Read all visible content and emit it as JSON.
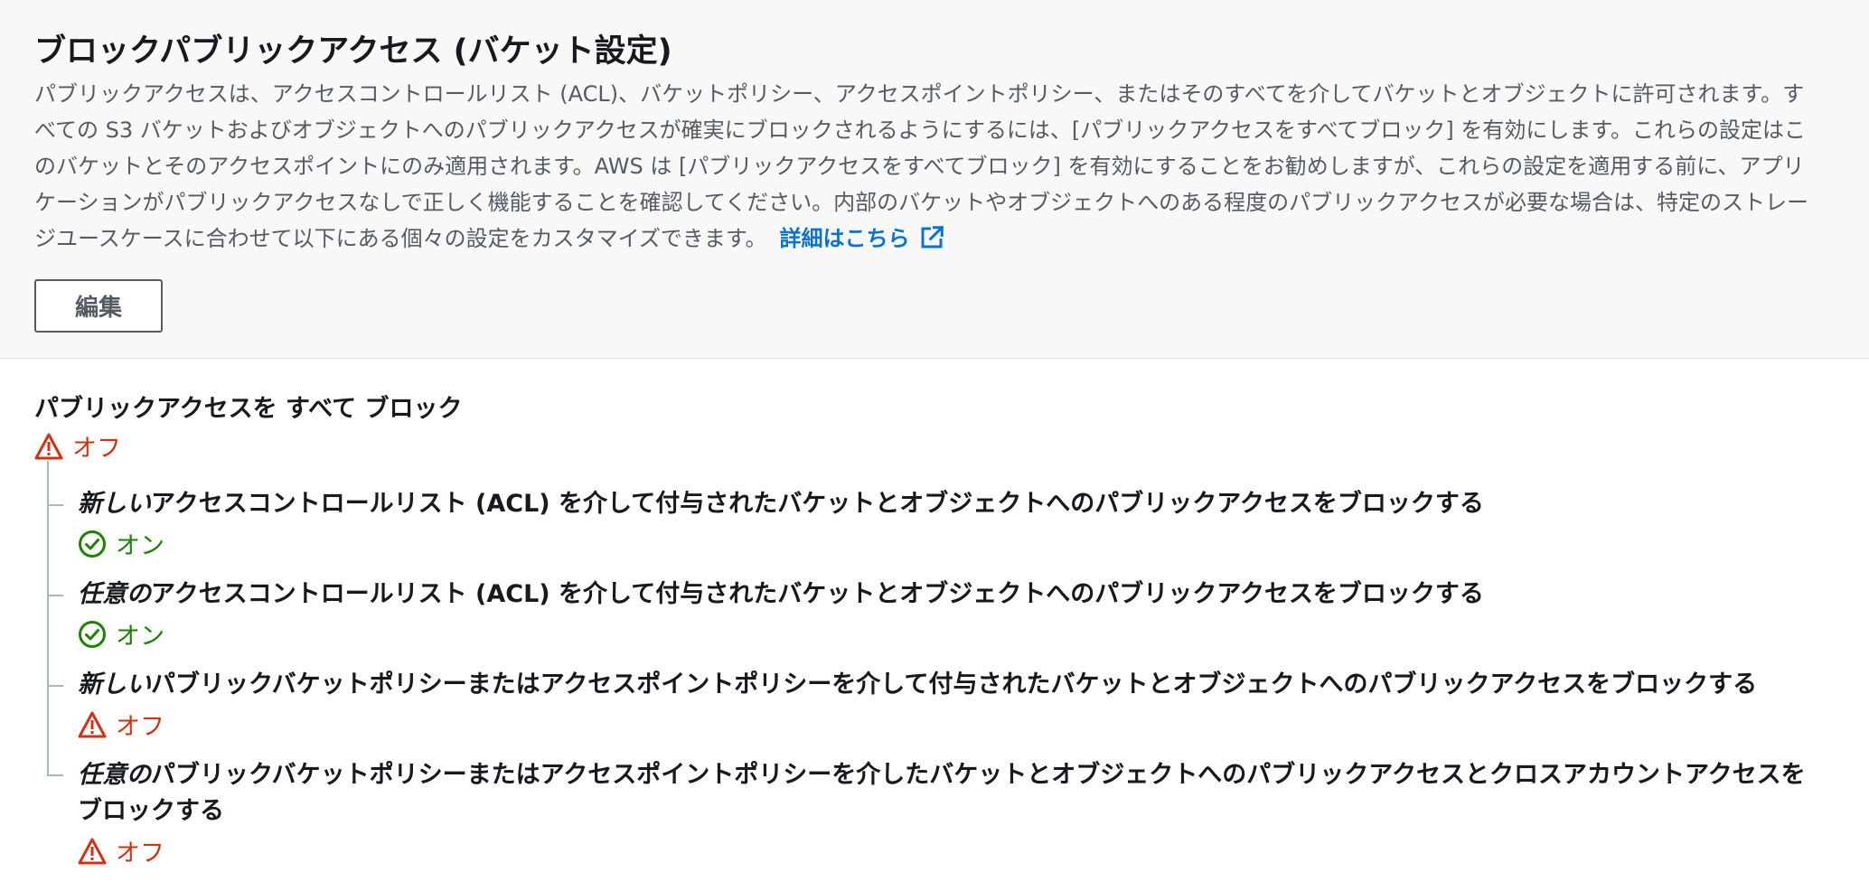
{
  "header": {
    "title": "ブロックパブリックアクセス (バケット設定)",
    "description": "パブリックアクセスは、アクセスコントロールリスト (ACL)、バケットポリシー、アクセスポイントポリシー、またはそのすべてを介してバケットとオブジェクトに許可されます。すべての S3 バケットおよびオブジェクトへのパブリックアクセスが確実にブロックされるようにするには、[パブリックアクセスをすべてブロック] を有効にします。これらの設定はこのバケットとそのアクセスポイントにのみ適用されます。AWS は [パブリックアクセスをすべてブロック] を有効にすることをお勧めしますが、これらの設定を適用する前に、アプリケーションがパブリックアクセスなしで正しく機能することを確認してください。内部のバケットやオブジェクトへのある程度のパブリックアクセスが必要な場合は、特定のストレージユースケースに合わせて以下にある個々の設定をカスタマイズできます。",
    "learn_more_link": "詳細はこちら",
    "edit_button": "編集"
  },
  "block_all": {
    "label": "パブリックアクセスを すべて ブロック",
    "status": "オフ"
  },
  "settings": [
    {
      "emphasis": "新しい",
      "rest": "アクセスコントロールリスト (ACL) を介して付与されたバケットとオブジェクトへのパブリックアクセスをブロックする",
      "status": "オン"
    },
    {
      "emphasis": "任意の",
      "rest": "アクセスコントロールリスト (ACL) を介して付与されたバケットとオブジェクトへのパブリックアクセスをブロックする",
      "status": "オン"
    },
    {
      "emphasis": "新しい",
      "rest": "パブリックバケットポリシーまたはアクセスポイントポリシーを介して付与されたバケットとオブジェクトへのパブリックアクセスをブロックする",
      "status": "オフ"
    },
    {
      "emphasis": "任意の",
      "rest": "パブリックバケットポリシーまたはアクセスポイントポリシーを介したバケットとオブジェクトへのパブリックアクセスとクロスアカウントアクセスをブロックする",
      "status": "オフ"
    }
  ],
  "colors": {
    "off_status": "#d13212",
    "on_status": "#1d8102",
    "link": "#0972d3",
    "header_background": "#f8f8f8"
  },
  "icons": {
    "off": "warning-triangle-icon",
    "on": "check-circle-icon",
    "link": "external-link-icon"
  }
}
